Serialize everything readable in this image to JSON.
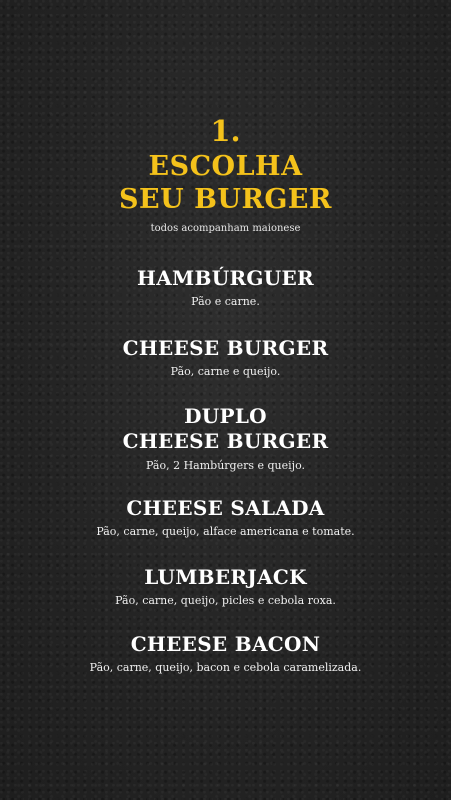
{
  "header": {
    "step_number": "1.",
    "title_line1": "ESCOLHA",
    "title_line2": "SEU BURGER",
    "subtitle": "todos acompanham maionese"
  },
  "colors": {
    "accent": "#f4c21b",
    "background": "#262626",
    "text": "#ffffff"
  },
  "items": [
    {
      "name": "HAMBÚRGUER",
      "description": "Pão e carne."
    },
    {
      "name": "CHEESE BURGER",
      "description": "Pão, carne e queijo."
    },
    {
      "name_line1": "DUPLO",
      "name_line2": "CHEESE BURGER",
      "description": "Pão, 2 Hambúrgers e queijo."
    },
    {
      "name": "CHEESE SALADA",
      "description": "Pão, carne, queijo, alface americana e tomate."
    },
    {
      "name": "LUMBERJACK",
      "description": "Pão, carne, queijo, picles e cebola roxa."
    },
    {
      "name": "CHEESE BACON",
      "description": "Pão, carne, queijo, bacon e cebola caramelizada."
    }
  ]
}
